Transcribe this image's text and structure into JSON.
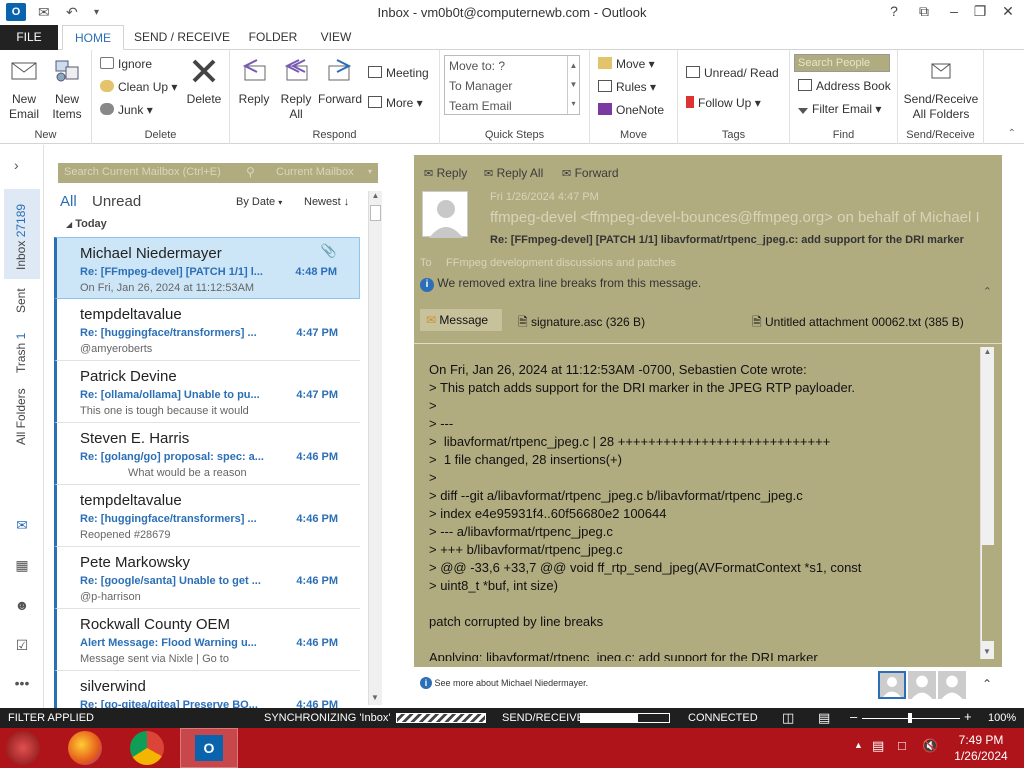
{
  "window": {
    "title": "Inbox - vm0b0t@computernewb.com - Outlook",
    "controls": [
      "?",
      "⧉",
      "–",
      "❐",
      "✕"
    ]
  },
  "ribbon_tabs": [
    "FILE",
    "HOME",
    "SEND / RECEIVE",
    "FOLDER",
    "VIEW"
  ],
  "ribbon": {
    "new": {
      "new_email": "New Email",
      "new_items": "New Items",
      "label": "New"
    },
    "delete": {
      "ignore": "Ignore",
      "cleanup": "Clean Up",
      "junk": "Junk",
      "delete": "Delete",
      "label": "Delete"
    },
    "respond": {
      "reply": "Reply",
      "reply_all": "Reply All",
      "forward": "Forward",
      "meeting": "Meeting",
      "more": "More",
      "label": "Respond"
    },
    "quick_steps": {
      "items": [
        "Move to: ?",
        "To Manager",
        "Team Email"
      ],
      "label": "Quick Steps"
    },
    "move": {
      "move": "Move",
      "rules": "Rules",
      "onenote": "OneNote",
      "label": "Move"
    },
    "tags": {
      "unread_read": "Unread/ Read",
      "follow_up": "Follow Up",
      "label": "Tags"
    },
    "find": {
      "search_people": "Search People",
      "address_book": "Address Book",
      "filter_email": "Filter Email",
      "label": "Find"
    },
    "send_receive": {
      "button": "Send/Receive All Folders",
      "label": "Send/Receive"
    }
  },
  "nav": {
    "folders": [
      {
        "name": "Inbox",
        "count": "27189"
      },
      {
        "name": "Sent",
        "count": ""
      },
      {
        "name": "Trash",
        "count": "1"
      },
      {
        "name": "All Folders",
        "count": ""
      }
    ]
  },
  "maillist": {
    "search_placeholder": "Search Current Mailbox (Ctrl+E)",
    "scope": "Current Mailbox",
    "filter_all": "All",
    "filter_unread": "Unread",
    "sort_by": "By Date",
    "sort_order": "Newest",
    "group": "Today",
    "items": [
      {
        "sender": "Michael Niedermayer",
        "subject": "Re: [FFmpeg-devel] [PATCH 1/1] l...",
        "time": "4:48 PM",
        "preview": "On Fri, Jan 26, 2024 at 11:12:53AM"
      },
      {
        "sender": "tempdeltavalue",
        "subject": "Re: [huggingface/transformers] ...",
        "time": "4:47 PM",
        "preview": "@amyeroberts"
      },
      {
        "sender": "Patrick Devine",
        "subject": "Re: [ollama/ollama] Unable to pu...",
        "time": "4:47 PM",
        "preview": "This one is tough because it would"
      },
      {
        "sender": "Steven E. Harris",
        "subject": "Re: [golang/go] proposal: spec: a...",
        "time": "4:46 PM",
        "preview": "What would be a reason"
      },
      {
        "sender": "tempdeltavalue",
        "subject": "Re: [huggingface/transformers] ...",
        "time": "4:46 PM",
        "preview": "Reopened #28679"
      },
      {
        "sender": "Pete Markowsky",
        "subject": "Re: [google/santa] Unable to get ...",
        "time": "4:46 PM",
        "preview": "@p-harrison"
      },
      {
        "sender": "Rockwall County OEM",
        "subject": "Alert Message: Flood Warning u...",
        "time": "4:46 PM",
        "preview": "Message sent via Nixle | Go to"
      },
      {
        "sender": "silverwind",
        "subject": "Re: [go-gitea/gitea] Preserve BO...",
        "time": "4:46 PM",
        "preview": ""
      }
    ]
  },
  "reading": {
    "actions": {
      "reply": "Reply",
      "reply_all": "Reply All",
      "forward": "Forward"
    },
    "date": "Fri 1/26/2024 4:47 PM",
    "from": "ffmpeg-devel <ffmpeg-devel-bounces@ffmpeg.org> on behalf of Michael I",
    "subject": "Re: [FFmpeg-devel] [PATCH 1/1] libavformat/rtpenc_jpeg.c: add support for the DRI marker",
    "to_label": "To",
    "to": "FFmpeg development discussions and patches",
    "info": "We removed extra line breaks from this message.",
    "attachments": [
      {
        "name": "Message"
      },
      {
        "name": "signature.asc (326 B)"
      },
      {
        "name": "Untitled attachment 00062.txt (385 B)"
      }
    ],
    "body": [
      "On Fri, Jan 26, 2024 at 11:12:53AM -0700, Sebastien Cote wrote:",
      "> This patch adds support for the DRI marker in the JPEG RTP payloader.",
      ">",
      "> ---",
      ">  libavformat/rtpenc_jpeg.c | 28 ++++++++++++++++++++++++++++",
      ">  1 file changed, 28 insertions(+)",
      ">",
      "> diff --git a/libavformat/rtpenc_jpeg.c b/libavformat/rtpenc_jpeg.c",
      "> index e4e95931f4..60f56680e2 100644",
      "> --- a/libavformat/rtpenc_jpeg.c",
      "> +++ b/libavformat/rtpenc_jpeg.c",
      "> @@ -33,6 +33,7 @@ void ff_rtp_send_jpeg(AVFormatContext *s1, const",
      "> uint8_t *buf, int size)",
      "",
      "patch corrupted by line breaks",
      "",
      "Applying: libavformat/rtpenc_jpeg.c: add support for the DRI marker"
    ],
    "people_pane": "See more about Michael Niedermayer."
  },
  "status": {
    "filter": "FILTER APPLIED",
    "sync": "SYNCHRONIZING  'Inbox'",
    "send_receive": "SEND/RECEIVE",
    "connected": "CONNECTED",
    "zoom": "100%",
    "sync_progress": 1.0,
    "send_receive_progress": 0.65
  },
  "taskbar": {
    "time": "7:49 PM",
    "date": "1/26/2024"
  },
  "colors": {
    "accent": "#2b6fb6",
    "tan": "#b1ab80",
    "taskbar": "#b0141b"
  }
}
